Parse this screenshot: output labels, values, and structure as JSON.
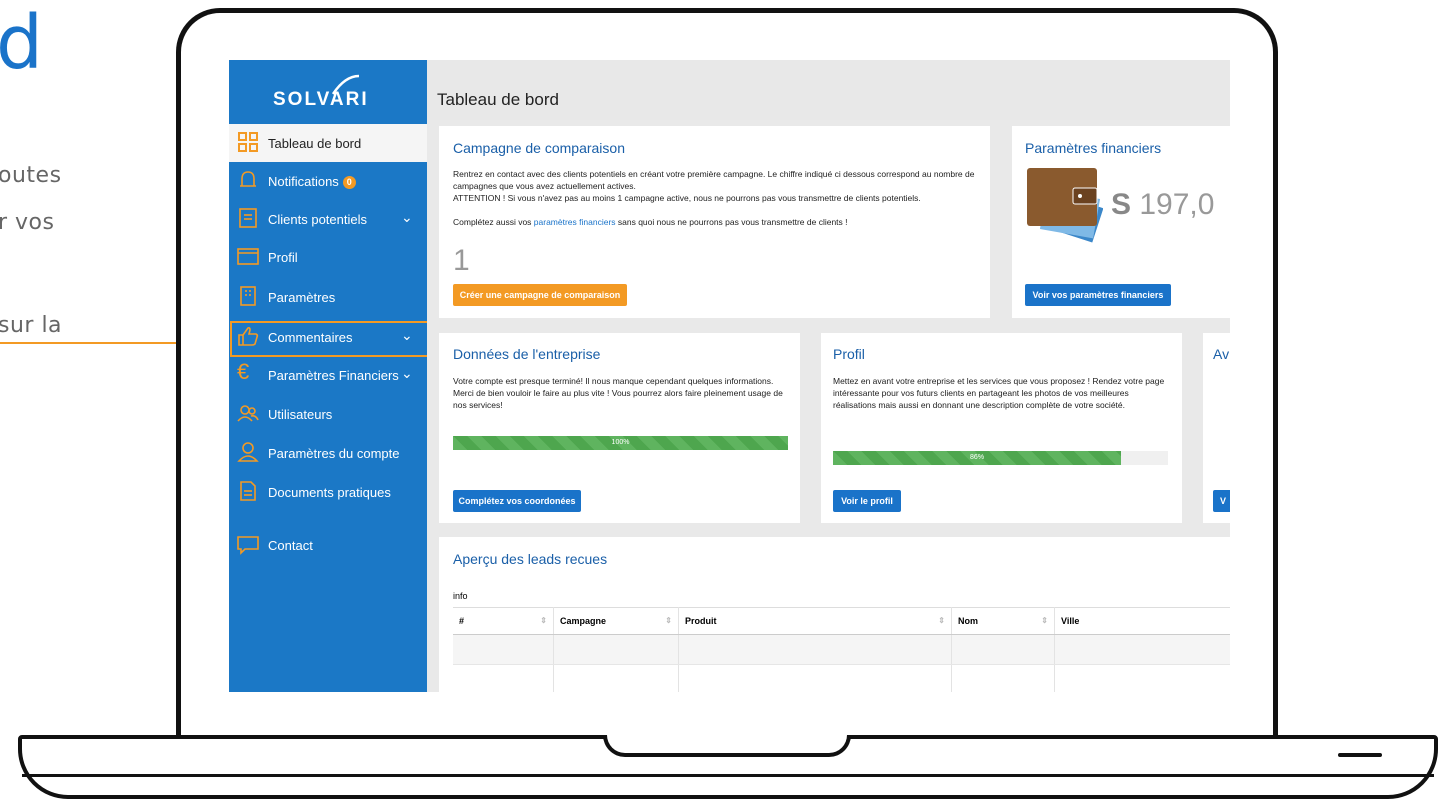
{
  "outside": {
    "title_fragment": "d",
    "lines": [
      "outes",
      "r vos",
      "sur la"
    ]
  },
  "logo": {
    "text": "SOLVARI"
  },
  "sidebar": {
    "items": [
      {
        "label": "Tableau de bord",
        "icon": "grid-icon",
        "active": true
      },
      {
        "label": "Notifications",
        "icon": "bell-icon",
        "badge": "0"
      },
      {
        "label": "Clients potentiels",
        "icon": "list-icon",
        "chevron": true
      },
      {
        "label": "Profil",
        "icon": "browser-icon"
      },
      {
        "label": "Paramètres",
        "icon": "building-icon"
      },
      {
        "label": "Commentaires",
        "icon": "thumbs-up-icon",
        "chevron": true,
        "highlighted": true
      },
      {
        "label": "Paramètres Financiers",
        "icon": "euro-icon",
        "chevron": true
      },
      {
        "label": "Utilisateurs",
        "icon": "users-icon"
      },
      {
        "label": "Paramètres du compte",
        "icon": "user-icon"
      },
      {
        "label": "Documents pratiques",
        "icon": "document-icon"
      },
      {
        "label": "Contact",
        "icon": "chat-icon"
      }
    ]
  },
  "header": {
    "title": "Tableau de bord"
  },
  "campaign": {
    "title": "Campagne de comparaison",
    "text1": "Rentrez en contact avec des clients potentiels en créant votre première campagne. Le chiffre indiqué ci dessous correspond au nombre de campagnes que vous avez actuellement actives.",
    "text2": "ATTENTION ! Si vous n'avez pas au moins 1 campagne active, nous ne pourrons pas vous transmettre de clients potentiels.",
    "text3_prefix": "Complétez aussi vos ",
    "text3_link": "paramètres financiers",
    "text3_suffix": " sans quoi nous ne pourrons pas vous transmettre de clients !",
    "count": "1",
    "button": "Créer une campagne de comparaison"
  },
  "finance": {
    "title": "Paramètres financiers",
    "currency": "S",
    "amount": "197,0",
    "button": "Voir vos paramètres financiers"
  },
  "company": {
    "title": "Données de l'entreprise",
    "text": "Votre compte est presque terminé! Il nous manque cependant quelques informations. Merci de bien vouloir le faire au plus vite ! Vous pourrez alors faire pleinement usage de nos services!",
    "progress": 100,
    "progress_label": "100%",
    "button": "Complétez vos coordonées"
  },
  "profile": {
    "title": "Profil",
    "text": "Mettez en avant votre entreprise et les services que vous proposez ! Rendez votre page intéressante pour vos futurs clients en partageant les photos de vos meilleures réalisations mais aussi en donnant une description complète de votre société.",
    "progress": 86,
    "progress_label": "86%",
    "button": "Voir le profil"
  },
  "third_card": {
    "title_fragment": "Av",
    "button_fragment": "V"
  },
  "leads": {
    "title": "Aperçu des leads recues",
    "info": "info",
    "columns": [
      "#",
      "Campagne",
      "Produit",
      "Nom",
      "Ville"
    ]
  },
  "colors": {
    "sidebar": "#1b78c6",
    "accent": "#f39a24",
    "link": "#1a73c9"
  }
}
